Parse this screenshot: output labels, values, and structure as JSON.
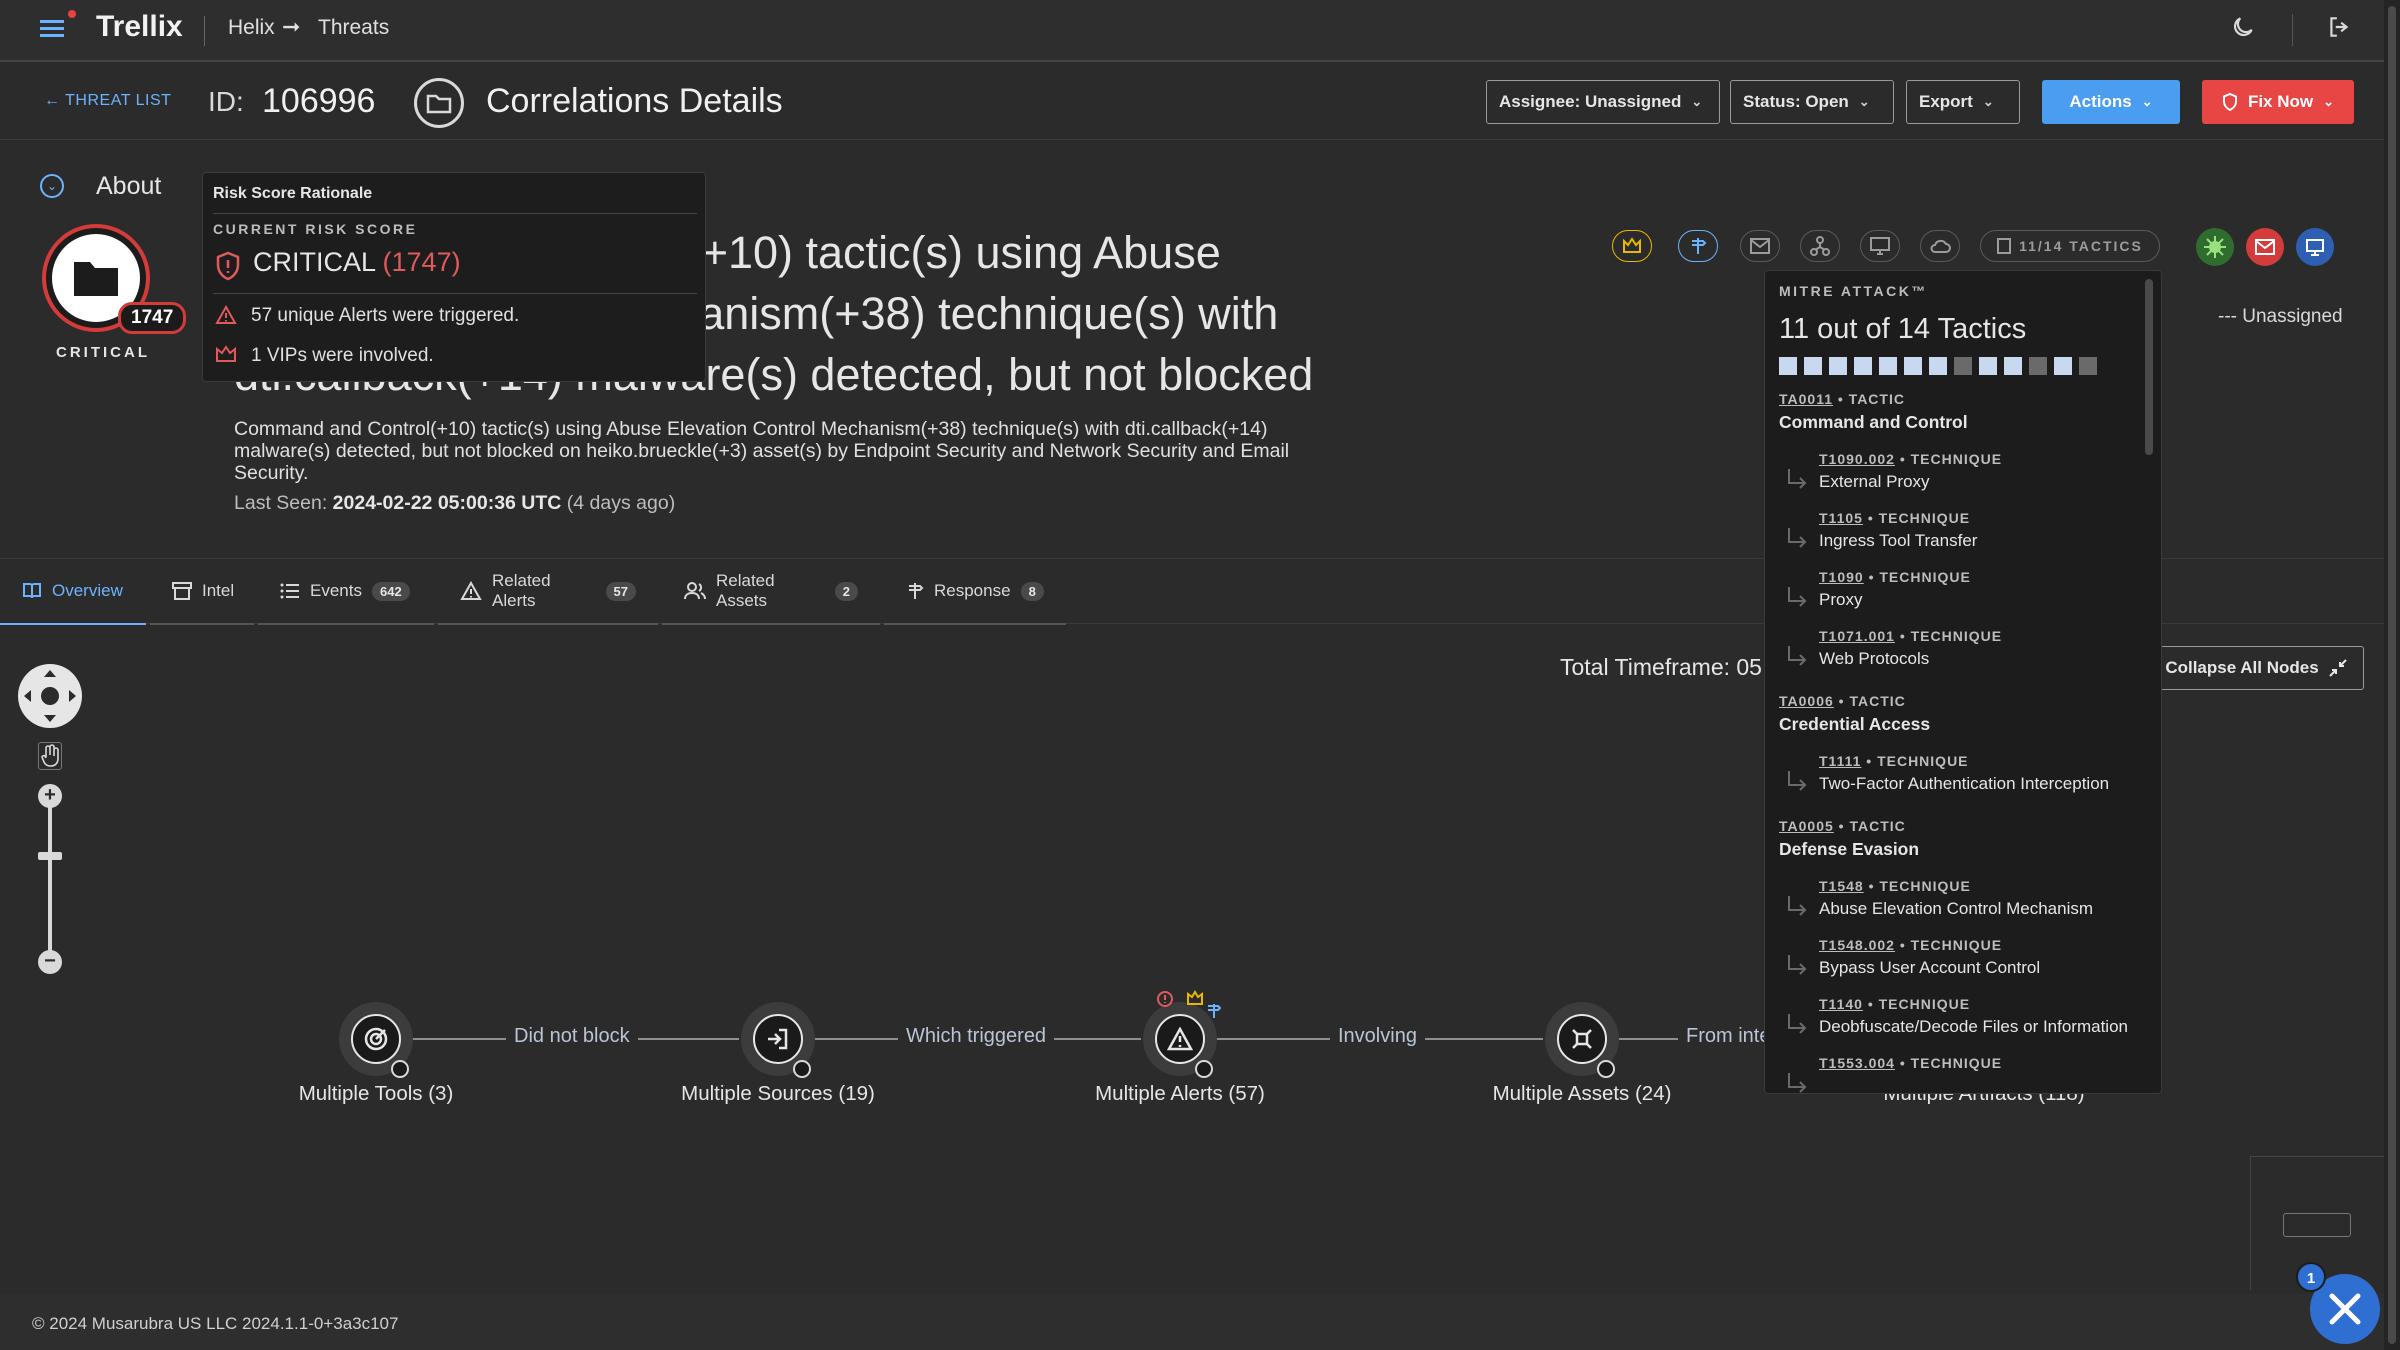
{
  "topbar": {
    "logo": "Trellix",
    "breadcrumb": [
      "Helix",
      "Threats"
    ],
    "breadcrumb_arrow": "➞"
  },
  "header": {
    "back_label": "THREAT LIST",
    "id_label": "ID:",
    "id_value": "106996",
    "title": "Correlations Details",
    "assignee": "Assignee: Unassigned",
    "status": "Status: Open",
    "export": "Export",
    "actions": "Actions",
    "fix_now": "Fix Now"
  },
  "about": {
    "label": "About",
    "risk_score": "1747",
    "risk_level": "CRITICAL",
    "headline_lines": [
      "Command and Control(+10) tactic(s) using Abuse",
      "Elevation Control Mechanism(+38) technique(s) with",
      "dti.callback(+14) malware(s) detected, but not blocked"
    ],
    "description": "Command and Control(+10) tactic(s) using Abuse Elevation Control Mechanism(+38) technique(s) with dti.callback(+14) malware(s) detected, but not blocked on heiko.brueckle(+3) asset(s) by Endpoint Security and Network Security and Email Security.",
    "last_seen_label": "Last Seen:",
    "last_seen_value": "2024-02-22 05:00:36 UTC",
    "last_seen_ago": "(4 days ago)",
    "tactics_pill": "11/14 TACTICS",
    "assignee_value": "--- Unassigned"
  },
  "risk_tooltip": {
    "title": "Risk Score Rationale",
    "subtitle": "CURRENT RISK SCORE",
    "level": "CRITICAL",
    "score": "(1747)",
    "lines": [
      "57 unique Alerts were triggered.",
      "1 VIPs were involved."
    ]
  },
  "tabs": [
    {
      "label": "Overview",
      "count": ""
    },
    {
      "label": "Intel",
      "count": ""
    },
    {
      "label": "Events",
      "count": "642"
    },
    {
      "label": "Related Alerts",
      "count": "57"
    },
    {
      "label": "Related Assets",
      "count": "2"
    },
    {
      "label": "Response",
      "count": "8"
    }
  ],
  "graph": {
    "timeframe": "Total Timeframe: 05",
    "collapse_label": "Collapse All Nodes",
    "nodes": [
      "Multiple Tools (3)",
      "Multiple Sources (19)",
      "Multiple Alerts (57)",
      "Multiple Assets (24)",
      "Multiple Artifacts (118)"
    ],
    "edges": [
      "Did not block",
      "Which triggered",
      "Involving",
      "From inte"
    ]
  },
  "mitre": {
    "header": "MITRE ATTACK™",
    "title": "11 out of 14 Tactics",
    "squares": [
      "on",
      "on",
      "on",
      "on",
      "on",
      "on",
      "on",
      "off",
      "on",
      "on",
      "off",
      "on",
      "off"
    ],
    "items": [
      {
        "kind": "tactic",
        "id": "TA0011",
        "type": "TACTIC",
        "name": "Command and Control"
      },
      {
        "kind": "technique",
        "id": "T1090.002",
        "type": "TECHNIQUE",
        "name": "External Proxy"
      },
      {
        "kind": "technique",
        "id": "T1105",
        "type": "TECHNIQUE",
        "name": "Ingress Tool Transfer"
      },
      {
        "kind": "technique",
        "id": "T1090",
        "type": "TECHNIQUE",
        "name": "Proxy"
      },
      {
        "kind": "technique",
        "id": "T1071.001",
        "type": "TECHNIQUE",
        "name": "Web Protocols"
      },
      {
        "kind": "tactic",
        "id": "TA0006",
        "type": "TACTIC",
        "name": "Credential Access"
      },
      {
        "kind": "technique",
        "id": "T1111",
        "type": "TECHNIQUE",
        "name": "Two-Factor Authentication Interception"
      },
      {
        "kind": "tactic",
        "id": "TA0005",
        "type": "TACTIC",
        "name": "Defense Evasion"
      },
      {
        "kind": "technique",
        "id": "T1548",
        "type": "TECHNIQUE",
        "name": "Abuse Elevation Control Mechanism"
      },
      {
        "kind": "technique",
        "id": "T1548.002",
        "type": "TECHNIQUE",
        "name": "Bypass User Account Control"
      },
      {
        "kind": "technique",
        "id": "T1140",
        "type": "TECHNIQUE",
        "name": "Deobfuscate/Decode Files or Information"
      },
      {
        "kind": "technique",
        "id": "T1553.004",
        "type": "TECHNIQUE",
        "name": ""
      }
    ]
  },
  "footer": {
    "copyright": "© 2024 Musarubra US LLC   2024.1.1-0+3a3c107"
  },
  "help": {
    "badge": "1"
  },
  "colors": {
    "accent": "#6cb3ff",
    "critical": "#d43b3b",
    "actions_button": "#4a9df0",
    "fix_button": "#e84545",
    "help_fab": "#2f6fd1"
  }
}
